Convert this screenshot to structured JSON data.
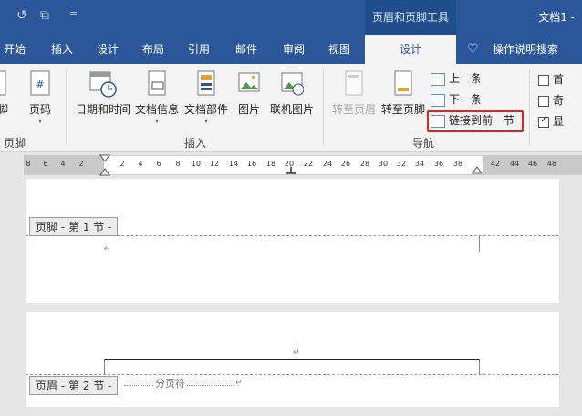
{
  "window": {
    "title": "文档1 -",
    "context_tools": "页眉和页脚工具"
  },
  "tabs": [
    {
      "label": "开始"
    },
    {
      "label": "插入"
    },
    {
      "label": "设计"
    },
    {
      "label": "布局"
    },
    {
      "label": "引用"
    },
    {
      "label": "邮件"
    },
    {
      "label": "审阅"
    },
    {
      "label": "视图"
    },
    {
      "label": "设计"
    },
    {
      "label": "操作说明搜索"
    }
  ],
  "ribbon": {
    "left_partial": "脚",
    "page_number": "页码",
    "group_left_label": "页脚",
    "insert": {
      "date_time": "日期和时间",
      "doc_info": "文档信息",
      "doc_parts": "文档部件",
      "picture": "图片",
      "online_picture": "联机图片",
      "group_label": "插入"
    },
    "navigation": {
      "goto_header": "转至页眉",
      "goto_footer": "转至页脚",
      "previous": "上一条",
      "next": "下一条",
      "link_previous": "链接到前一节",
      "group_label": "导航"
    },
    "options": [
      "首",
      "奇",
      "显"
    ]
  },
  "ruler": {
    "ticks": [
      "8",
      "6",
      "4",
      "2",
      "2",
      "4",
      "6",
      "8",
      "10",
      "12",
      "14",
      "16",
      "18",
      "20",
      "22",
      "24",
      "26",
      "28",
      "30",
      "32",
      "34",
      "36",
      "38",
      "42",
      "44",
      "46",
      "48"
    ]
  },
  "document": {
    "footer_label": "页脚 - 第 1 节 -",
    "header_label": "页眉 - 第 2 节 -",
    "section_break": "分页符",
    "para_mark": "↵"
  }
}
